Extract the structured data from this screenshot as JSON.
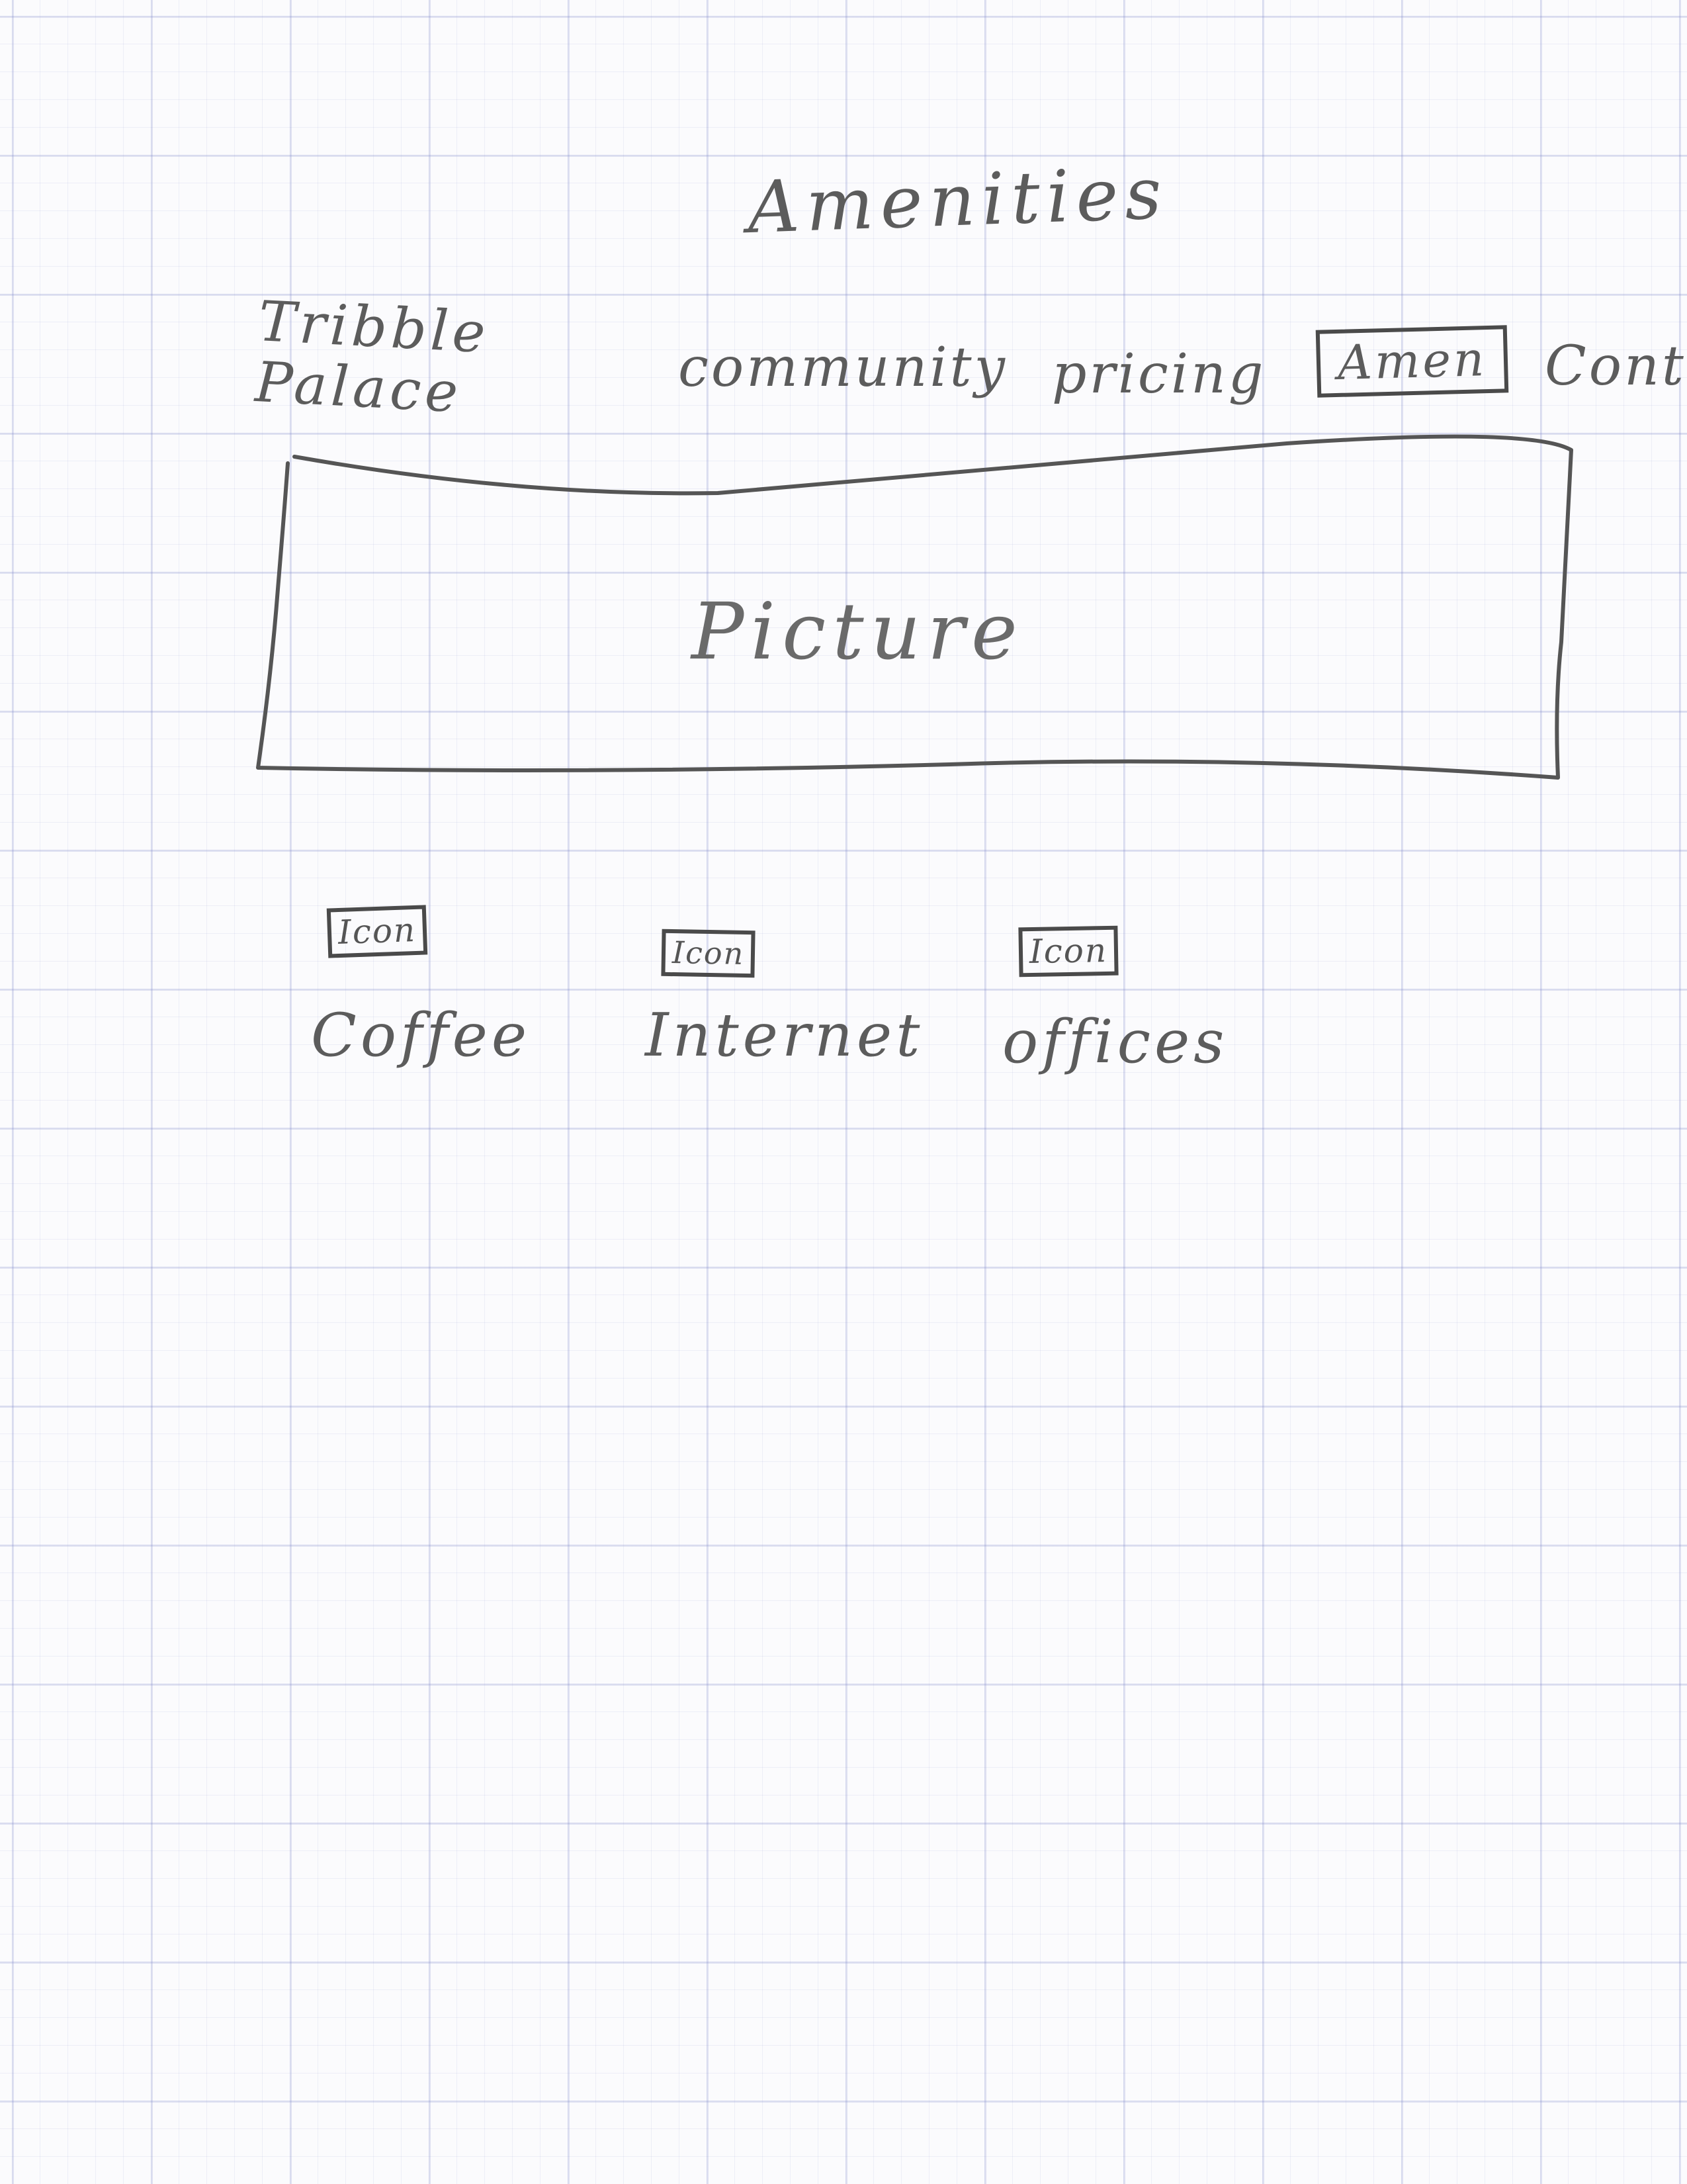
{
  "page": {
    "title": "Amenities"
  },
  "header": {
    "brand": "Tribble Palace",
    "nav": [
      {
        "label": "community",
        "active": false
      },
      {
        "label": "pricing",
        "active": false
      },
      {
        "label": "Amen",
        "active": true
      },
      {
        "label": "Cont",
        "active": false
      }
    ]
  },
  "hero": {
    "label": "Picture"
  },
  "amenities": [
    {
      "icon_label": "Icon",
      "icon": "coffee-icon",
      "label": "Coffee"
    },
    {
      "icon_label": "Icon",
      "icon": "internet-icon",
      "label": "Internet"
    },
    {
      "icon_label": "Icon",
      "icon": "offices-icon",
      "label": "offices"
    }
  ]
}
